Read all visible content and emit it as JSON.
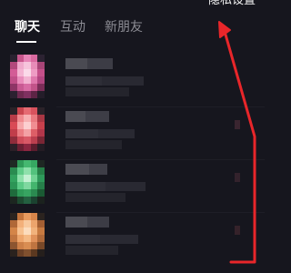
{
  "header": {
    "settings_label": "隐私设置"
  },
  "tabs": [
    {
      "label": "聊天",
      "active": true
    },
    {
      "label": "互动",
      "active": false
    },
    {
      "label": "新朋友",
      "active": false
    }
  ],
  "chats": [
    {
      "avatar_accent": "#e05a9a"
    },
    {
      "avatar_accent": "#e25565"
    },
    {
      "avatar_accent": "#3dba6e"
    },
    {
      "avatar_accent": "#ea8d46"
    }
  ],
  "colors": {
    "background": "#16161e",
    "annotation_arrow": "#e8262a",
    "tab_active": "#ffffff",
    "tab_inactive": "#8c8c94"
  }
}
